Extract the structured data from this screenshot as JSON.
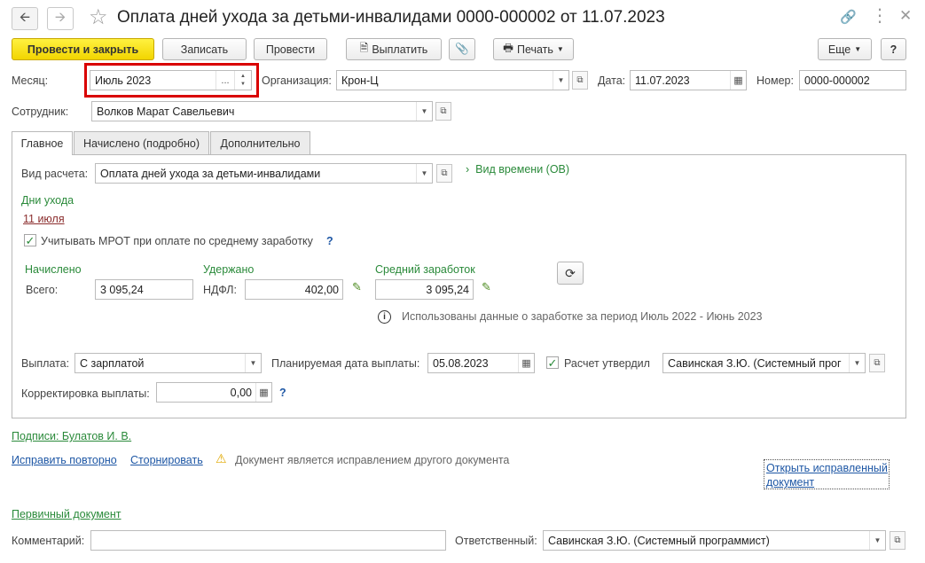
{
  "window": {
    "title": "Оплата дней ухода за детьми-инвалидами 0000-000002 от 11.07.2023"
  },
  "toolbar": {
    "post_close": "Провести и закрыть",
    "save": "Записать",
    "post": "Провести",
    "pay": "Выплатить",
    "print": "Печать",
    "more": "Еще",
    "help": "?"
  },
  "header": {
    "month_label": "Месяц:",
    "month_value": "Июль 2023",
    "org_label": "Организация:",
    "org_value": "Крон-Ц",
    "date_label": "Дата:",
    "date_value": "11.07.2023",
    "number_label": "Номер:",
    "number_value": "0000-000002",
    "employee_label": "Сотрудник:",
    "employee_value": "Волков Марат Савельевич"
  },
  "tabs": [
    "Главное",
    "Начислено (подробно)",
    "Дополнительно"
  ],
  "main": {
    "calc_type_label": "Вид расчета:",
    "calc_type_value": "Оплата дней ухода за детьми-инвалидами",
    "time_type_link": "Вид времени (ОВ)",
    "care_days_title": "Дни ухода",
    "care_days_link": "11 июля",
    "mrot_label": "Учитывать МРОТ при оплате по среднему заработку",
    "accrued_title": "Начислено",
    "total_label": "Всего:",
    "total_value": "3 095,24",
    "withheld_title": "Удержано",
    "ndfl_label": "НДФЛ:",
    "ndfl_value": "402,00",
    "avg_title": "Средний заработок",
    "avg_value": "3 095,24",
    "info_text": "Использованы данные о заработке за период Июль 2022 - Июнь 2023",
    "payout_label": "Выплата:",
    "payout_value": "С зарплатой",
    "planned_date_label": "Планируемая дата выплаты:",
    "planned_date_value": "05.08.2023",
    "approved_label": "Расчет утвердил",
    "approved_value": "Савинская З.Ю. (Системный прог",
    "correction_label": "Корректировка выплаты:",
    "correction_value": "0,00"
  },
  "footer": {
    "signatures_link": "Подписи: Булатов И. В.",
    "fix_again_link": "Исправить повторно",
    "reverse_link": "Сторнировать",
    "warning_text": "Документ является исправлением другого документа",
    "open_fixed_link_1": "Открыть исправленный",
    "open_fixed_link_2": "документ",
    "primary_doc_link": "Первичный документ",
    "comment_label": "Комментарий:",
    "comment_value": "",
    "responsible_label": "Ответственный:",
    "responsible_value": "Савинская З.Ю. (Системный программист)"
  }
}
